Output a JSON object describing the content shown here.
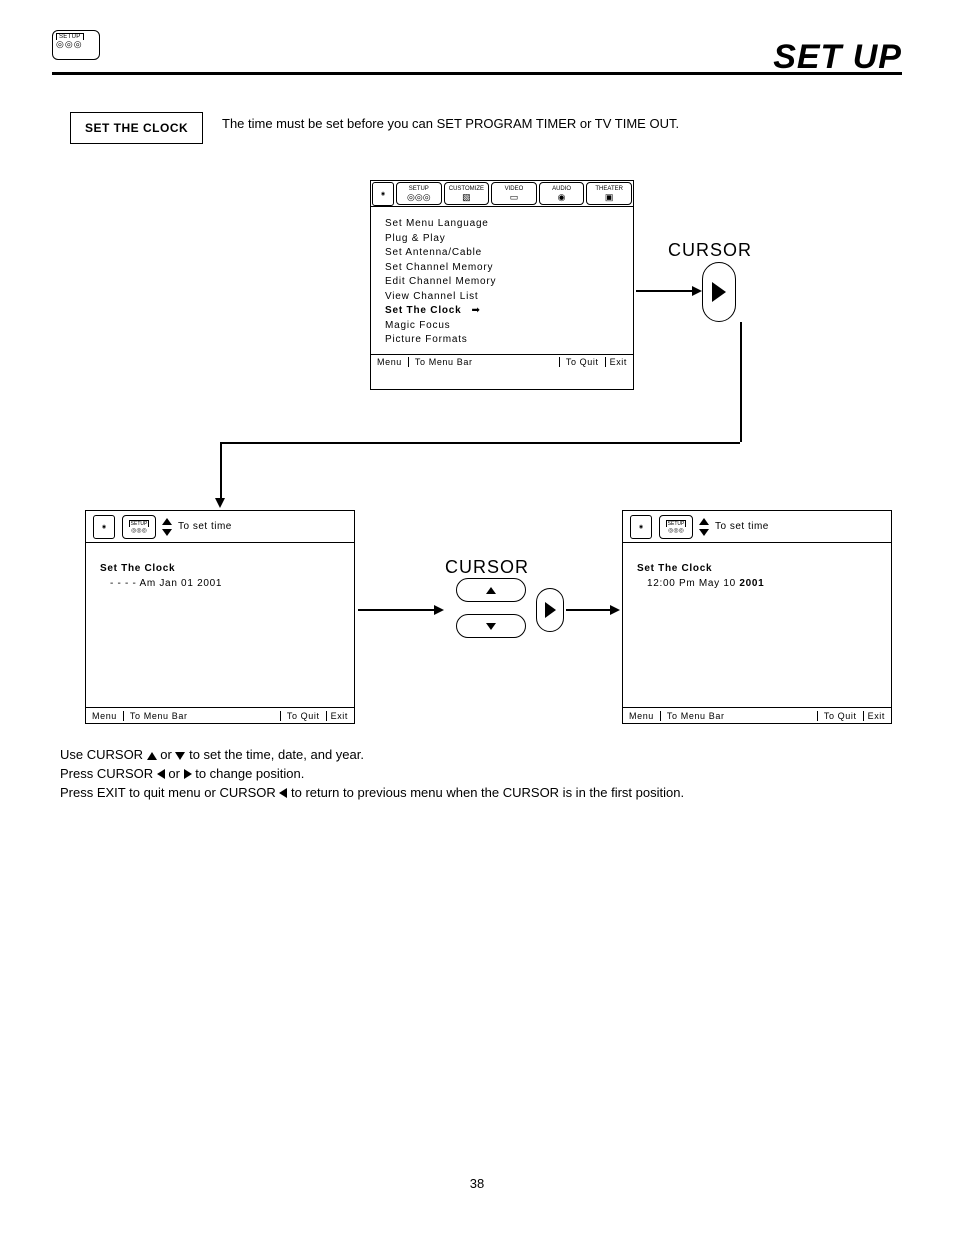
{
  "page": {
    "title": "SET UP",
    "badge_label": "SETUP",
    "number": "38"
  },
  "section": {
    "label": "SET THE CLOCK",
    "description": "The time must be set before you can  SET PROGRAM TIMER or TV TIME OUT."
  },
  "mainMenu": {
    "tabs": [
      "SETUP",
      "CUSTOMIZE",
      "VIDEO",
      "AUDIO",
      "THEATER"
    ],
    "items": [
      "Set Menu Language",
      "Plug & Play",
      "Set Antenna/Cable",
      "Set Channel Memory",
      "Edit Channel Memory",
      "View Channel List",
      "Set The Clock",
      "Magic Focus",
      "Picture Formats"
    ],
    "selected_index": 6,
    "footer": {
      "menu": "Menu",
      "mid": "To Menu Bar",
      "quit": "To Quit",
      "exit": "Exit"
    }
  },
  "cursor_label": "CURSOR",
  "clock1": {
    "setup_tab": "SETUP",
    "header_text": "To set time",
    "title": "Set The Clock",
    "value": "- -   - - Am Jan 01 2001",
    "footer": {
      "menu": "Menu",
      "mid": "To Menu Bar",
      "quit": "To Quit",
      "exit": "Exit"
    }
  },
  "clock2": {
    "setup_tab": "SETUP",
    "header_text": "To set time",
    "title": "Set The Clock",
    "value_pre": "12:00 Pm May 10 ",
    "value_bold": "2001",
    "footer": {
      "menu": "Menu",
      "mid": "To Menu Bar",
      "quit": "To Quit",
      "exit": "Exit"
    }
  },
  "instructions": {
    "line1a": "Use CURSOR ",
    "line1b": " or ",
    "line1c": " to set the time, date, and year.",
    "line2a": "Press CURSOR ",
    "line2b": " or ",
    "line2c": " to change position.",
    "line3a": "Press EXIT to quit menu or CURSOR ",
    "line3b": " to return to previous menu when the CURSOR is in the first position."
  }
}
